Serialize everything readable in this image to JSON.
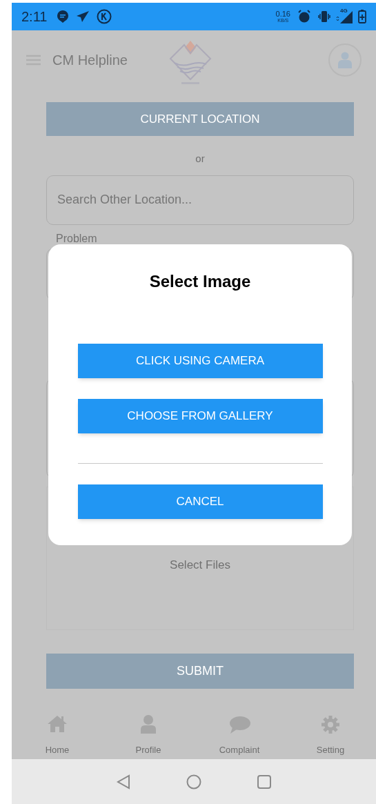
{
  "status_bar": {
    "time": "2:11",
    "net_speed": "0.16",
    "net_unit": "KB/S",
    "network": "4G"
  },
  "header": {
    "title": "CM Helpline"
  },
  "form": {
    "location_button": "CURRENT LOCATION",
    "separator": "or",
    "search_placeholder": "Search Other Location...",
    "problem_label": "Problem",
    "files_label": "Select Files",
    "submit_button": "SUBMIT"
  },
  "tabs": [
    {
      "label": "Home"
    },
    {
      "label": "Profile"
    },
    {
      "label": "Complaint"
    },
    {
      "label": "Setting"
    }
  ],
  "dialog": {
    "title": "Select Image",
    "options": [
      "CLICK USING CAMERA",
      "CHOOSE FROM GALLERY"
    ],
    "cancel": "CANCEL"
  }
}
